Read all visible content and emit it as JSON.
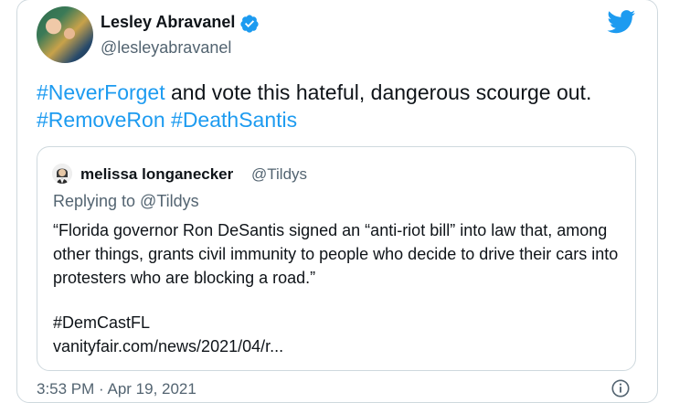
{
  "author": {
    "display_name": "Lesley Abravanel",
    "handle": "@lesleyabravanel"
  },
  "tweet": {
    "segments": [
      {
        "text": "#NeverForget",
        "hashtag": true
      },
      {
        "text": " and vote this hateful, dangerous scourge out. ",
        "hashtag": false
      },
      {
        "text": "#RemoveRon",
        "hashtag": true
      },
      {
        "text": " ",
        "hashtag": false
      },
      {
        "text": "#DeathSantis",
        "hashtag": true
      }
    ]
  },
  "quote": {
    "display_name": "melissa longanecker",
    "handle": "@Tildys",
    "replying_to": "Replying to @Tildys",
    "body": "“Florida governor Ron DeSantis signed an “anti-riot bill” into law that, among other things, grants civil immunity to people who decide to drive their cars into protesters who are  blocking a road.”",
    "hashtag": "#DemCastFL",
    "link": "vanityfair.com/news/2021/04/r..."
  },
  "timestamp": "3:53 PM · Apr 19, 2021",
  "icons": {
    "verified": "verified-badge-icon",
    "brand": "twitter-bird-icon",
    "info": "info-icon"
  },
  "colors": {
    "accent": "#1d9bf0",
    "text": "#0f1419",
    "secondary": "#536471",
    "border": "#cfd9de"
  }
}
